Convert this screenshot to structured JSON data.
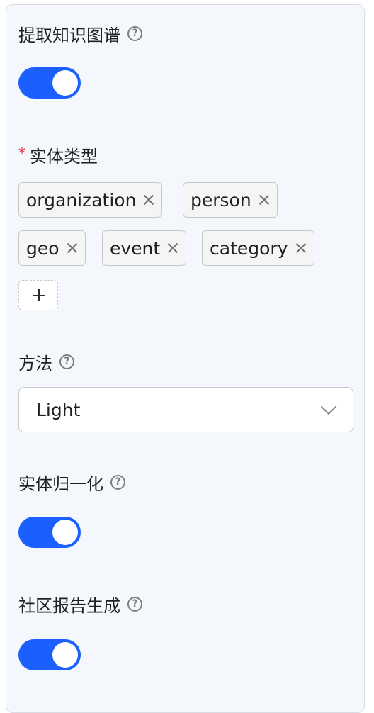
{
  "knowledge_graph": {
    "label": "提取知识图谱",
    "help_icon": "question-circle-icon",
    "enabled": true
  },
  "entity_types": {
    "required_mark": "*",
    "label": "实体类型",
    "tags": [
      "organization",
      "person",
      "geo",
      "event",
      "category"
    ],
    "add_icon": "plus-icon"
  },
  "method": {
    "label": "方法",
    "help_icon": "question-circle-icon",
    "selected": "Light",
    "dropdown_icon": "chevron-down-icon"
  },
  "entity_resolution": {
    "label": "实体归一化",
    "help_icon": "question-circle-icon",
    "enabled": true
  },
  "community_report": {
    "label": "社区报告生成",
    "help_icon": "question-circle-icon",
    "enabled": true
  },
  "colors": {
    "switch_on": "#1b5fff",
    "required": "#f5222d",
    "panel_bg": "#f4f7fb"
  }
}
